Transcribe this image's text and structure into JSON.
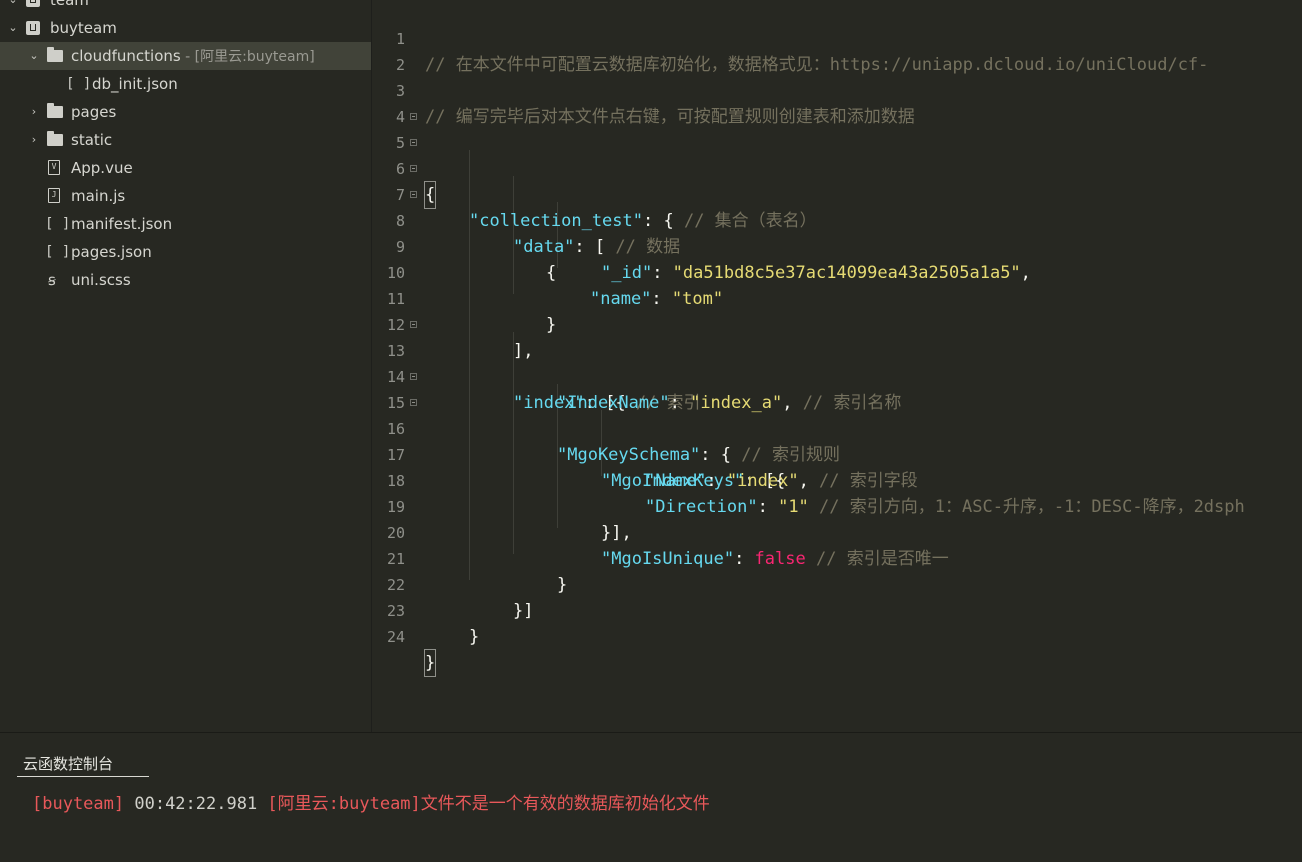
{
  "sidebar": {
    "items": [
      {
        "label": "team",
        "suffix": "",
        "level": 0
      },
      {
        "label": "buyteam",
        "suffix": "",
        "level": 0
      },
      {
        "label": "cloudfunctions",
        "suffix": " - [阿里云:buyteam]",
        "level": 1
      },
      {
        "label": "db_init.json",
        "suffix": "",
        "level": 2
      },
      {
        "label": "pages",
        "suffix": "",
        "level": 1
      },
      {
        "label": "static",
        "suffix": "",
        "level": 1
      },
      {
        "label": "App.vue",
        "suffix": "",
        "level": 1
      },
      {
        "label": "main.js",
        "suffix": "",
        "level": 1
      },
      {
        "label": "manifest.json",
        "suffix": "",
        "level": 1
      },
      {
        "label": "pages.json",
        "suffix": "",
        "level": 1
      },
      {
        "label": "uni.scss",
        "suffix": "",
        "level": 1
      }
    ]
  },
  "editor": {
    "lines": [
      {
        "n": "1",
        "t": "// 在本文件中可配置云数据库初始化，数据格式见：https://uniapp.dcloud.io/uniCloud/cf-"
      },
      {
        "n": "2",
        "t": ""
      },
      {
        "n": "3",
        "t": "// 编写完毕后对本文件点右键，可按配置规则创建表和添加数据"
      },
      {
        "n": "4",
        "t": ""
      },
      {
        "n": "5",
        "t": "{"
      },
      {
        "n": "6",
        "t": "\"collection_test\"",
        "t2": ": { ",
        "t3": "// 集合（表名）"
      },
      {
        "n": "7",
        "t": "\"data\"",
        "t2": ": [ ",
        "t3": "// 数据"
      },
      {
        "n": "8",
        "t": "{"
      },
      {
        "n": "9",
        "t": "\"_id\"",
        "t2": ": ",
        "t3": "\"da51bd8c5e37ac14099ea43a2505a1a5\"",
        "t4": ","
      },
      {
        "n": "10",
        "t": "\"name\"",
        "t2": ": ",
        "t3": "\"tom\""
      },
      {
        "n": "11",
        "t": "}"
      },
      {
        "n": "12",
        "t": "],"
      },
      {
        "n": "13",
        "t": "\"index\"",
        "t2": ": [{ ",
        "t3": "// 索引"
      },
      {
        "n": "14",
        "t": "\"IndexName\"",
        "t2": ": ",
        "t3": "\"index_a\"",
        "t4": ", ",
        "t5": "// 索引名称"
      },
      {
        "n": "15",
        "t": "\"MgoKeySchema\"",
        "t2": ": { ",
        "t3": "// 索引规则"
      },
      {
        "n": "16",
        "t": "\"MgoIndexKeys\"",
        "t2": ": [{"
      },
      {
        "n": "17",
        "t": "\"Name\"",
        "t2": ": ",
        "t3": "\"index\"",
        "t4": ", ",
        "t5": "// 索引字段"
      },
      {
        "n": "18",
        "t": "\"Direction\"",
        "t2": ": ",
        "t3": "\"1\"",
        "t4": " ",
        "t5": "// 索引方向，1：ASC-升序，-1：DESC-降序，2dsph"
      },
      {
        "n": "19",
        "t": "}],"
      },
      {
        "n": "20",
        "t": "\"MgoIsUnique\"",
        "t2": ": ",
        "t3": "false",
        "t4": " ",
        "t5": "// 索引是否唯一"
      },
      {
        "n": "21",
        "t": "}"
      },
      {
        "n": "22",
        "t": "}]"
      },
      {
        "n": "23",
        "t": "}"
      },
      {
        "n": "24",
        "t": "}"
      }
    ]
  },
  "console": {
    "tab_label": "云函数控制台",
    "log_project": "[buyteam]",
    "log_time": " 00:42:22.981 ",
    "log_message": "[阿里云:buyteam]文件不是一个有效的数据库初始化文件"
  },
  "colors": {
    "background": "#272822",
    "comment": "#75715e",
    "key": "#66d9ef",
    "string": "#e6db74",
    "boolean": "#f92672",
    "error": "#e8585a"
  }
}
